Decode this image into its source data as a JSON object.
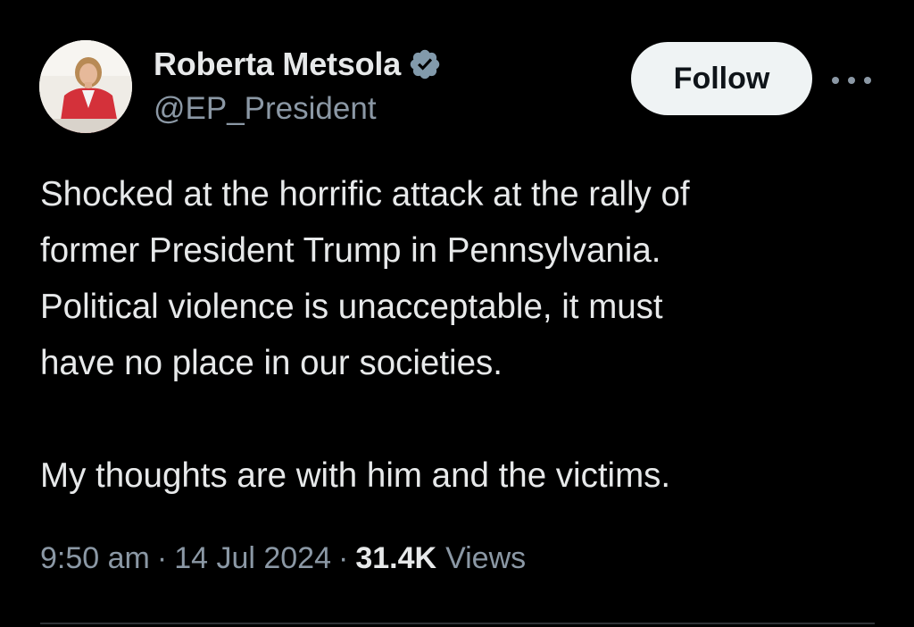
{
  "author": {
    "display_name": "Roberta Metsola",
    "handle": "@EP_President",
    "verified": true
  },
  "actions": {
    "follow_label": "Follow",
    "more_icon": "more-horizontal-icon"
  },
  "tweet": {
    "paragraphs": [
      "Shocked at the horrific attack at the rally of",
      "former President Trump in Pennsylvania.",
      "Political violence is unacceptable, it must",
      "have no place in our societies.",
      "My thoughts are with him and the victims."
    ]
  },
  "meta": {
    "time": "9:50 am",
    "separator": "·",
    "date": "14 Jul 2024",
    "views_count": "31.4K",
    "views_label": "Views"
  },
  "colors": {
    "background": "#000000",
    "primary_text": "#e7e9ea",
    "secondary_text": "#8b98a5",
    "follow_bg": "#eff3f4",
    "verified_badge": "#829aab",
    "divider": "#2f3336"
  }
}
